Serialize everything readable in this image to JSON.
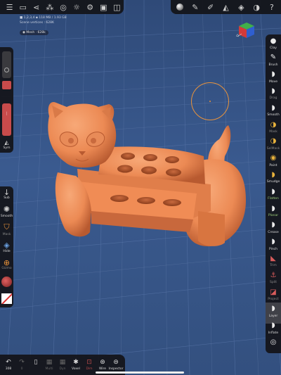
{
  "top_left_toolbar": {
    "icons": [
      "hamburger-menu-icon",
      "folder-icon",
      "share-icon",
      "scene-tree-icon",
      "material-sphere-icon",
      "sun-settings-icon",
      "gear-icon",
      "image-icon",
      "camera-icon"
    ]
  },
  "top_right_toolbar": {
    "icons": [
      "matcap-sphere-icon",
      "pen-icon",
      "brush-icon",
      "painting-icon",
      "layers-icon",
      "shaded-sphere-icon",
      "help-icon"
    ]
  },
  "info": {
    "line1": "■ 1,2,3,4 ▪ 118 MB / 1.93 GB",
    "line2": "Scene vertices : 628K"
  },
  "mesh_tag": "◉ Mesh · 628k",
  "left_panel": {
    "radius_value": "",
    "sym_label": "Sym"
  },
  "left_panel2": {
    "sub_label": "Sub",
    "smooth_label": "Smooth",
    "mask_label": "Mask",
    "hide_label": "Hide",
    "gizmo_label": "Gizmo"
  },
  "tools": [
    {
      "label": "Clay",
      "state": "normal"
    },
    {
      "label": "Brush",
      "state": "normal"
    },
    {
      "label": "Move",
      "state": "normal"
    },
    {
      "label": "Drag",
      "state": "dim"
    },
    {
      "label": "Smooth",
      "state": "normal"
    },
    {
      "label": "Mask",
      "state": "dim"
    },
    {
      "label": "SelMask",
      "state": "dim"
    },
    {
      "label": "Paint",
      "state": "normal"
    },
    {
      "label": "Smudge",
      "state": "normal"
    },
    {
      "label": "Flatten",
      "state": "normal"
    },
    {
      "label": "Planar",
      "state": "normal"
    },
    {
      "label": "Crease",
      "state": "normal"
    },
    {
      "label": "Pinch",
      "state": "normal"
    },
    {
      "label": "Trim",
      "state": "dim"
    },
    {
      "label": "Split",
      "state": "dim"
    },
    {
      "label": "Project",
      "state": "dim"
    },
    {
      "label": "Layer",
      "state": "selected"
    },
    {
      "label": "Inflate",
      "state": "normal"
    },
    {
      "label": "",
      "state": "normal"
    }
  ],
  "bottom_toolbar": [
    {
      "icon": "undo-icon",
      "label": "308",
      "state": "normal"
    },
    {
      "icon": "redo-icon",
      "label": "0",
      "state": "dim"
    },
    {
      "icon": "phone-icon",
      "label": "",
      "state": "normal"
    },
    {
      "icon": "multires-icon",
      "label": "Multi",
      "state": "dim"
    },
    {
      "icon": "dyntopo-icon",
      "label": "Dyn",
      "state": "dim"
    },
    {
      "icon": "voxel-icon",
      "label": "Voxel",
      "state": "normal"
    },
    {
      "icon": "dims-icon",
      "label": "Dim",
      "state": "dim"
    },
    {
      "icon": "wireframe-icon",
      "label": "Wire",
      "state": "normal"
    },
    {
      "icon": "inspector-icon",
      "label": "Inspector",
      "state": "normal"
    }
  ],
  "colors": {
    "model": "#f0915c",
    "model_shadow": "#c9663a",
    "accent_red": "#c84b4b",
    "background": "#3a5a8f"
  }
}
